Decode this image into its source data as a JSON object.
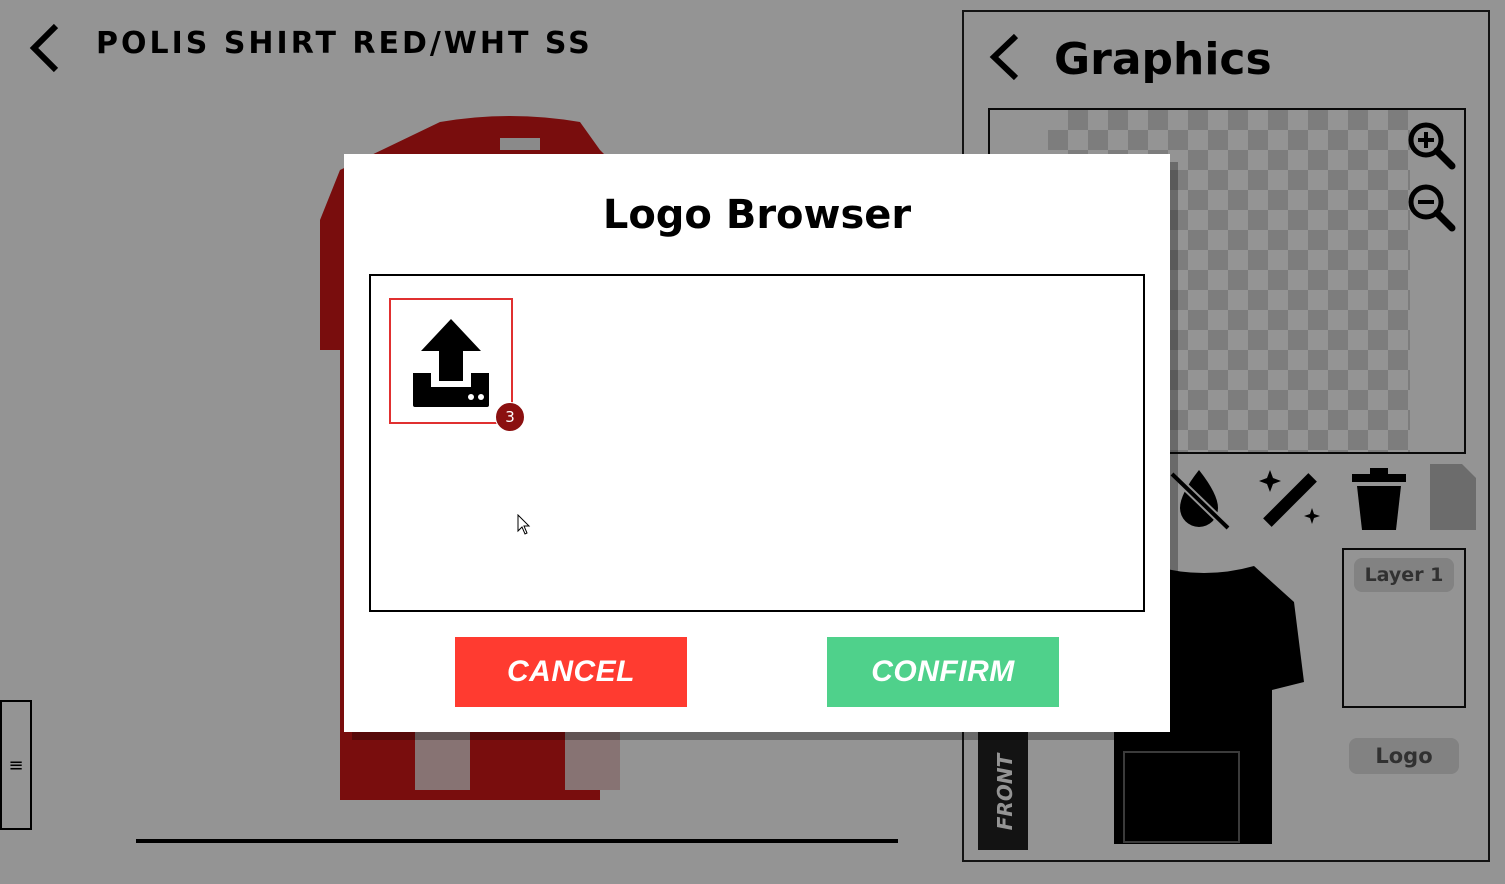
{
  "header": {
    "title": "POLIS SHIRT RED/WHT SS"
  },
  "sidebar_toggle": {
    "symbol": "≡"
  },
  "graphics_panel": {
    "title": "Graphics",
    "layers": [
      {
        "label": "Layer 1"
      }
    ],
    "logo_label": "Logo",
    "view_tab": "FRONT",
    "tools": [
      "droplet-off-icon",
      "magic-wand-icon",
      "trash-icon",
      "file-icon"
    ]
  },
  "dialog": {
    "title": "Logo Browser",
    "upload_badge": "3",
    "cancel_label": "CANCEL",
    "confirm_label": "CONFIRM"
  },
  "colors": {
    "cancel": "#ff3b30",
    "confirm": "#4fd18b",
    "badge": "#8b1010",
    "shirt": "#d01818"
  }
}
